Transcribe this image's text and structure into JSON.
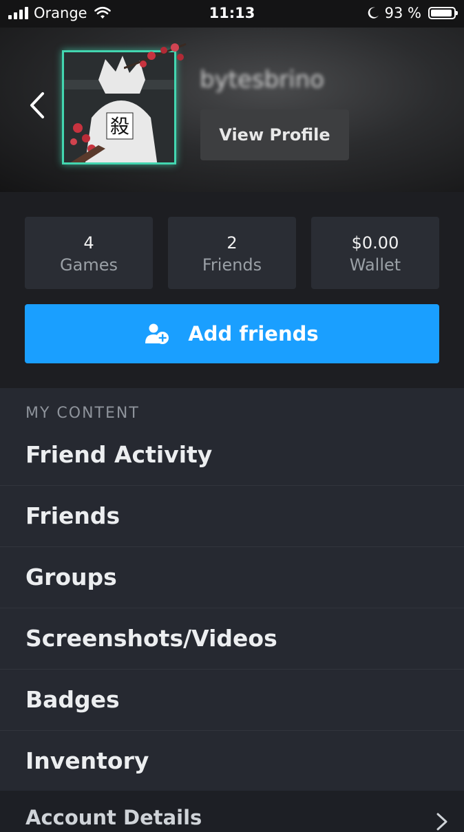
{
  "status_bar": {
    "carrier": "Orange",
    "time": "11:13",
    "battery_percent": "93 %",
    "battery_level": 0.93
  },
  "profile": {
    "username": "bytesbrino",
    "view_profile_label": "View Profile"
  },
  "stats": [
    {
      "value": "4",
      "label": "Games"
    },
    {
      "value": "2",
      "label": "Friends"
    },
    {
      "value": "$0.00",
      "label": "Wallet"
    }
  ],
  "actions": {
    "add_friends_label": "Add friends"
  },
  "menu": {
    "section_title": "MY CONTENT",
    "items": [
      {
        "label": "Friend Activity"
      },
      {
        "label": "Friends"
      },
      {
        "label": "Groups"
      },
      {
        "label": "Screenshots/Videos"
      },
      {
        "label": "Badges"
      },
      {
        "label": "Inventory"
      }
    ],
    "footer_label": "Account Details"
  },
  "colors": {
    "accent": "#1a9fff",
    "frame": "#43d6b0",
    "background": "#262931"
  },
  "icons": {
    "back": "chevron-left-icon",
    "add_friend": "person-plus-icon",
    "footer": "chevron-right-icon"
  }
}
